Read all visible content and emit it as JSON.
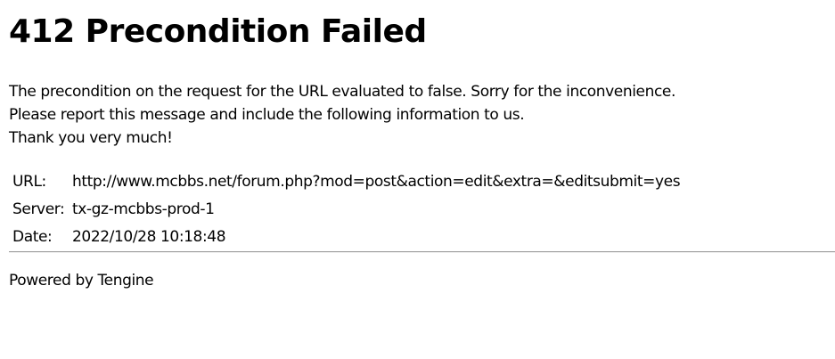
{
  "title": "412 Precondition Failed",
  "message_lines": [
    "The precondition on the request for the URL evaluated to false. Sorry for the inconvenience.",
    "Please report this message and include the following information to us.",
    "Thank you very much!"
  ],
  "details": [
    {
      "label": "URL:",
      "value": "http://www.mcbbs.net/forum.php?mod=post&action=edit&extra=&editsubmit=yes"
    },
    {
      "label": "Server:",
      "value": "tx-gz-mcbbs-prod-1"
    },
    {
      "label": "Date:",
      "value": "2022/10/28 10:18:48"
    }
  ],
  "footer": "Powered by Tengine"
}
